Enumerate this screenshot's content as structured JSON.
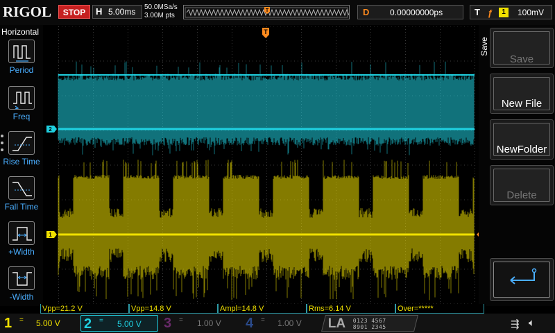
{
  "header": {
    "brand": "RIGOL",
    "run_status": "STOP",
    "timebase_letter": "H",
    "timebase_scale": "5.00ms",
    "sample_rate": "50.0MSa/s",
    "memory_depth": "3.00M pts",
    "trigger_marker": "T",
    "delay_letter": "D",
    "delay_value": "0.00000000ps",
    "trigger_letter": "T",
    "trigger_edge_icon": "rising-edge-icon",
    "trigger_source": "1",
    "trigger_level": "100mV"
  },
  "left_menu": {
    "title": "Horizontal",
    "items": [
      {
        "label": "Period",
        "icon": "period-icon"
      },
      {
        "label": "Freq",
        "icon": "frequency-icon"
      },
      {
        "label": "Rise Time",
        "icon": "rise-time-icon"
      },
      {
        "label": "Fall Time",
        "icon": "fall-time-icon"
      },
      {
        "label": "+Width",
        "icon": "positive-width-icon"
      },
      {
        "label": "-Width",
        "icon": "negative-width-icon"
      }
    ]
  },
  "right_menu": {
    "title": "Save",
    "softkeys": [
      {
        "label": "Save",
        "enabled": false
      },
      {
        "label": "New File",
        "enabled": true
      },
      {
        "label": "NewFolder",
        "enabled": true
      },
      {
        "label": "Delete",
        "enabled": false
      },
      {
        "label": "",
        "icon": "return-arrow-icon",
        "enabled": true
      }
    ]
  },
  "waveform": {
    "trigger_top_marker": "T",
    "trigger_level_marker": "T",
    "ch1_marker": "1",
    "ch2_marker": "2",
    "colors": {
      "ch1": "#f0e000",
      "ch2": "#1fd0e0",
      "ch3": "#d040d0",
      "ch4": "#3a7bff",
      "trigger": "#ff8a1e",
      "grid": "#3a3a3a"
    }
  },
  "measurements": [
    {
      "text": "Vpp=21.2 V"
    },
    {
      "text": "Vpp=14.8 V"
    },
    {
      "text": "Ampl=14.8 V"
    },
    {
      "text": "Rms=6.14 V"
    },
    {
      "text": "Over=*****"
    }
  ],
  "channels": [
    {
      "num": "1",
      "coupling": "=",
      "scale": "5.00 V",
      "color": "#f0e000",
      "active": true
    },
    {
      "num": "2",
      "coupling": "=",
      "scale": "5.00 V",
      "color": "#1fd0e0",
      "active": true
    },
    {
      "num": "3",
      "coupling": "=",
      "scale": "1.00 V",
      "color": "#7a2a7a",
      "active": false
    },
    {
      "num": "4",
      "coupling": "=",
      "scale": "1.00 V",
      "color": "#2a4a8a",
      "active": false
    }
  ],
  "logic_analyzer": {
    "label": "LA",
    "row1": "0123 4567",
    "row2": "8901 2345"
  },
  "status_icons": [
    "usb-icon",
    "speaker-mute-icon"
  ]
}
